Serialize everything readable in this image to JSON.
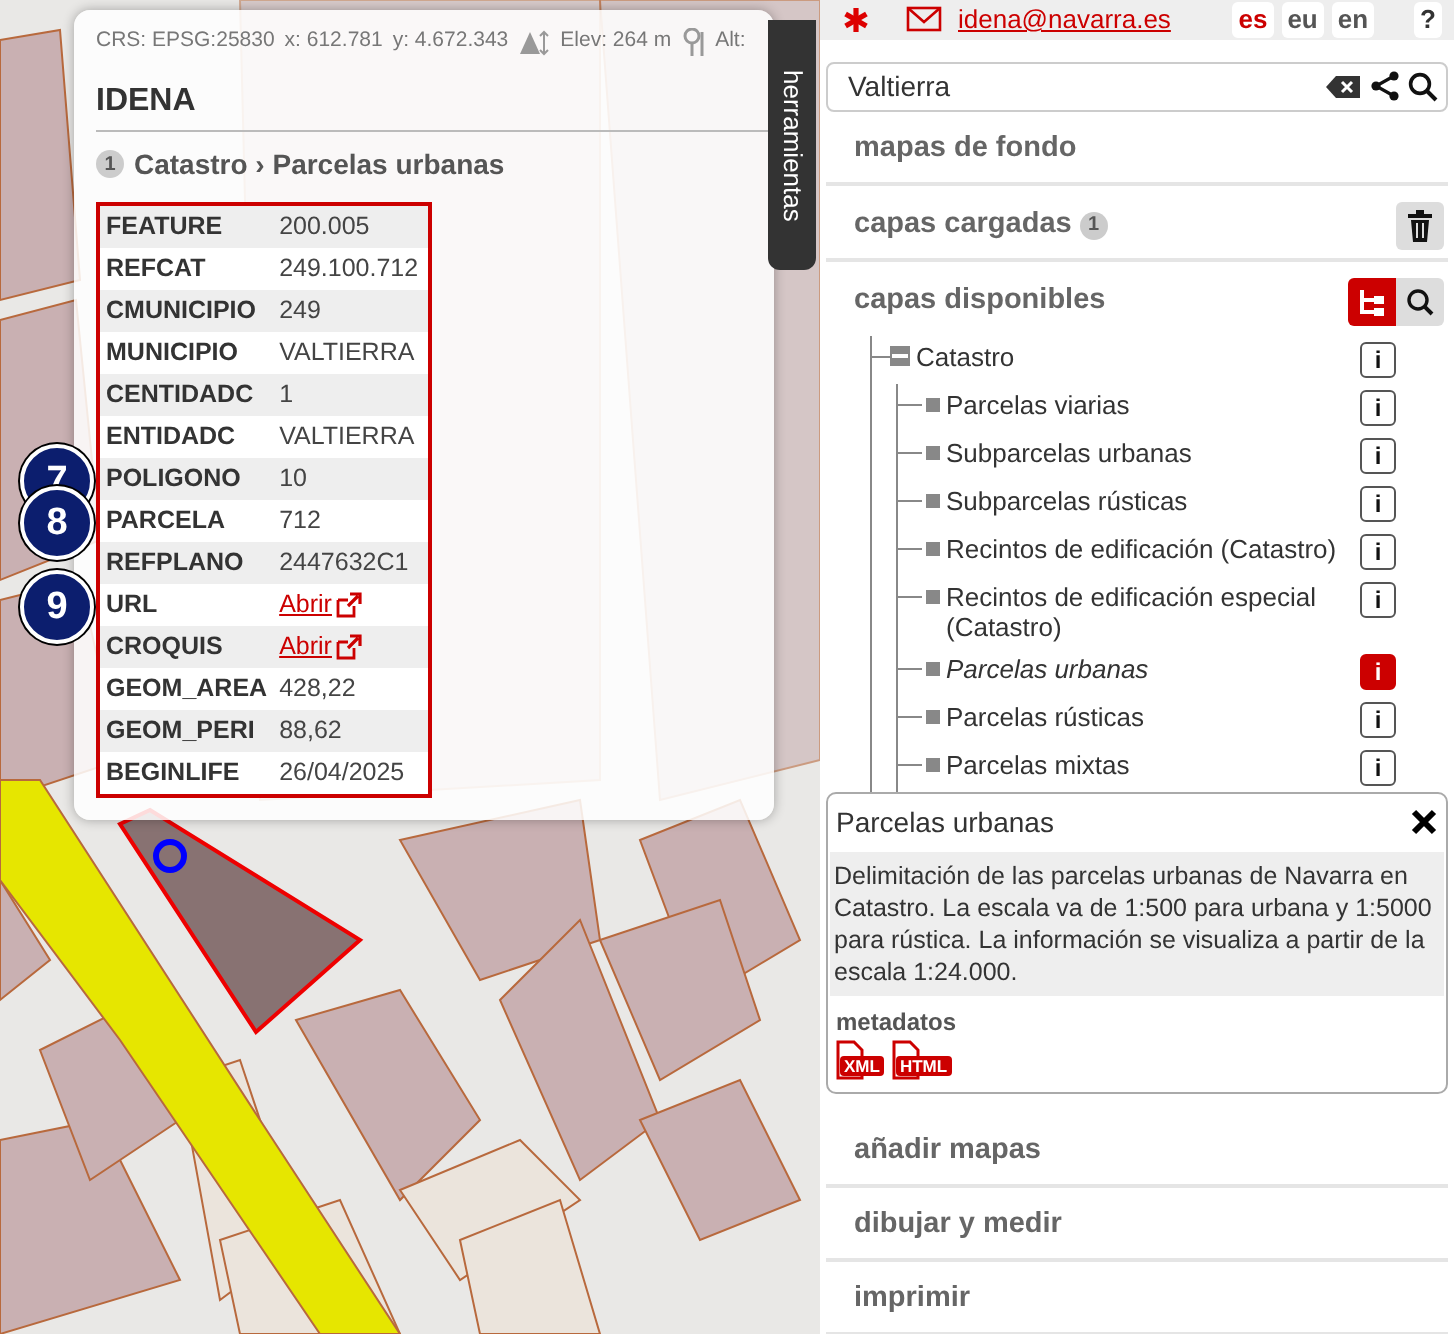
{
  "coords_bar": {
    "crs": "CRS: EPSG:25830",
    "x": "x: 612.781",
    "y": "y: 4.672.343",
    "elev": "Elev: 264 m",
    "alt": "Alt:"
  },
  "popup": {
    "title": "IDENA",
    "breadcrumb_count": "1",
    "breadcrumb": "Catastro › Parcelas urbanas",
    "rows": [
      {
        "label": "FEATURE",
        "value": "200.005",
        "kind": "text"
      },
      {
        "label": "REFCAT",
        "value": "249.100.712",
        "kind": "text"
      },
      {
        "label": "CMUNICIPIO",
        "value": "249",
        "kind": "text"
      },
      {
        "label": "MUNICIPIO",
        "value": "VALTIERRA",
        "kind": "text"
      },
      {
        "label": "CENTIDADC",
        "value": "1",
        "kind": "text"
      },
      {
        "label": "ENTIDADC",
        "value": "VALTIERRA",
        "kind": "text"
      },
      {
        "label": "POLIGONO",
        "value": "10",
        "kind": "text",
        "marker": "7"
      },
      {
        "label": "PARCELA",
        "value": "712",
        "kind": "text",
        "marker": "8"
      },
      {
        "label": "REFPLANO",
        "value": "2447632C1",
        "kind": "text"
      },
      {
        "label": "URL",
        "value": "Abrir",
        "kind": "link",
        "marker": "9"
      },
      {
        "label": "CROQUIS",
        "value": "Abrir",
        "kind": "link"
      },
      {
        "label": "GEOM_AREA",
        "value": "428,22",
        "kind": "text"
      },
      {
        "label": "GEOM_PERI",
        "value": "88,62",
        "kind": "text"
      },
      {
        "label": "BEGINLIFE",
        "value": "26/04/2025",
        "kind": "text"
      }
    ]
  },
  "tools_tab": "herramientas",
  "header": {
    "email": "idena@navarra.es",
    "languages": [
      {
        "label": "es",
        "selected": true
      },
      {
        "label": "eu",
        "selected": false
      },
      {
        "label": "en",
        "selected": false
      }
    ],
    "help": "?"
  },
  "search": {
    "value": "Valtierra"
  },
  "sections": [
    {
      "kind": "plain",
      "title": "mapas de fondo"
    },
    {
      "kind": "loaded",
      "title": "capas cargadas",
      "count": "1"
    },
    {
      "kind": "available",
      "title": "capas disponibles",
      "view_modes": [
        {
          "kind": "tree",
          "selected": true
        },
        {
          "kind": "search",
          "selected": false
        }
      ],
      "tree": [
        {
          "label": "Catastro",
          "info": "i",
          "selected": false,
          "expanded": true,
          "children": [
            {
              "label": "Parcelas viarias",
              "info": "i",
              "selected": false
            },
            {
              "label": "Subparcelas urbanas",
              "info": "i",
              "selected": false
            },
            {
              "label": "Subparcelas rústicas",
              "info": "i",
              "selected": false
            },
            {
              "label": "Recintos de edificación (Catastro)",
              "info": "i",
              "selected": false
            },
            {
              "label": "Recintos de edificación especial (Catastro)",
              "info": "i",
              "selected": false
            },
            {
              "label": "Parcelas urbanas",
              "info": "i",
              "selected": true
            },
            {
              "label": "Parcelas rústicas",
              "info": "i",
              "selected": false
            },
            {
              "label": "Parcelas mixtas",
              "info": "i",
              "selected": false
            }
          ]
        }
      ],
      "info_popover": {
        "title": "Parcelas urbanas",
        "description": "Delimitación de las parcelas urbanas de Navarra en Catastro. La escala va de 1:500 para urbana y 1:5000 para rústica. La información se visualiza a partir de la escala 1:24.000.",
        "metadata_label": "metadatos",
        "formats": [
          "XML",
          "HTML"
        ]
      }
    },
    {
      "kind": "plain",
      "title": "añadir mapas"
    },
    {
      "kind": "plain",
      "title": "dibujar y medir"
    },
    {
      "kind": "plain",
      "title": "imprimir"
    }
  ]
}
